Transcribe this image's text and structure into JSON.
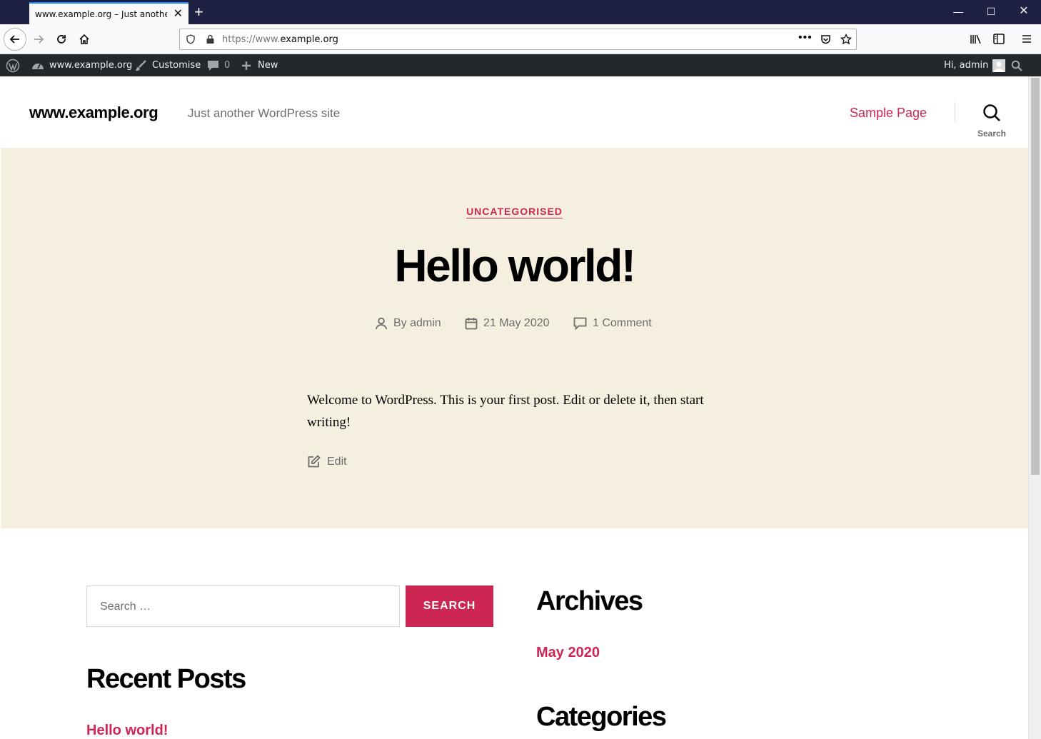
{
  "browser": {
    "tab_title": "www.example.org – Just another WordPress site",
    "url_prefix": "https://www.",
    "url_domain": "example.org"
  },
  "adminbar": {
    "site_name": "www.example.org",
    "customise": "Customise",
    "comments_count": "0",
    "new_label": "New",
    "greeting": "Hi, admin"
  },
  "header": {
    "site_title": "www.example.org",
    "tagline": "Just another WordPress site",
    "nav_sample_page": "Sample Page",
    "search_label": "Search"
  },
  "post": {
    "category": "UNCATEGORISED",
    "title": "Hello world!",
    "author": "By admin",
    "date": "21 May 2020",
    "comments": "1 Comment",
    "body": "Welcome to WordPress. This is your first post. Edit or delete it, then start writing!",
    "edit": "Edit"
  },
  "widgets": {
    "search_placeholder": "Search …",
    "search_button": "SEARCH",
    "recent_posts_title": "Recent Posts",
    "recent_posts": [
      "Hello world!"
    ],
    "archives_title": "Archives",
    "archives": [
      "May 2020"
    ],
    "categories_title": "Categories"
  },
  "colors": {
    "accent": "#cd2653",
    "hero_bg": "#f5efe0",
    "adminbar_bg": "#23282d",
    "titlebar_bg": "#1d1f43"
  }
}
